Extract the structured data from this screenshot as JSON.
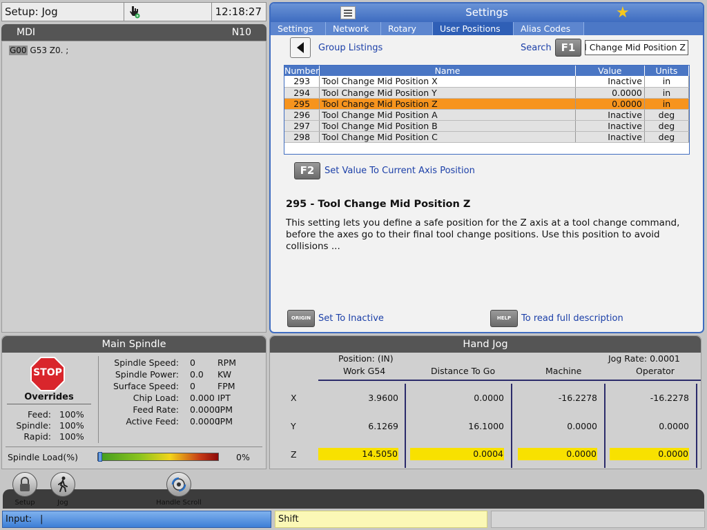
{
  "top": {
    "mode": "Setup: Jog",
    "clock": "12:18:27"
  },
  "mdi": {
    "title": "MDI",
    "line_no": "N10",
    "code_first": "G00",
    "code_rest": " G53 Z0. ;"
  },
  "settings": {
    "title": "Settings",
    "tabs": [
      "Settings",
      "Network",
      "Rotary",
      "User Positions",
      "Alias Codes"
    ],
    "group_listings": "Group Listings",
    "search_label": "Search",
    "f1": "F1",
    "search_value": "Tool Change Mid Position Z",
    "columns": [
      "Number",
      "Name",
      "Value",
      "Units"
    ],
    "rows": [
      {
        "num": "293",
        "name": "Tool Change Mid Position X",
        "value": "Inactive",
        "units": "in"
      },
      {
        "num": "294",
        "name": "Tool Change Mid Position Y",
        "value": "0.0000",
        "units": "in"
      },
      {
        "num": "295",
        "name": "Tool Change Mid Position Z",
        "value": "0.0000",
        "units": "in"
      },
      {
        "num": "296",
        "name": "Tool Change Mid Position A",
        "value": "Inactive",
        "units": "deg"
      },
      {
        "num": "297",
        "name": "Tool Change Mid Position B",
        "value": "Inactive",
        "units": "deg"
      },
      {
        "num": "298",
        "name": "Tool Change Mid Position C",
        "value": "Inactive",
        "units": "deg"
      }
    ],
    "f2": "F2",
    "f2_label": "Set Value To Current Axis Position",
    "desc_title": "295 - Tool Change Mid Position Z",
    "desc_text": "This setting lets you define a safe position for the Z axis at a tool change command, before the axes go to their final tool change positions. Use this position to avoid collisions ...",
    "origin_key": "ORIGIN",
    "origin_label": "Set To Inactive",
    "help_key": "HELP",
    "help_label": "To read full description"
  },
  "spindle": {
    "title": "Main Spindle",
    "stop": "STOP",
    "overrides": "Overrides",
    "ov": [
      {
        "label": "Feed:",
        "value": "100%"
      },
      {
        "label": "Spindle:",
        "value": "100%"
      },
      {
        "label": "Rapid:",
        "value": "100%"
      }
    ],
    "stats": [
      {
        "label": "Spindle Speed:",
        "value": "0",
        "unit": "RPM"
      },
      {
        "label": "Spindle Power:",
        "value": "0.0",
        "unit": "KW"
      },
      {
        "label": "Surface Speed:",
        "value": "0",
        "unit": "FPM"
      },
      {
        "label": "Chip Load:",
        "value": "0.000",
        "unit": "IPT"
      },
      {
        "label": "Feed Rate:",
        "value": "0.0000",
        "unit": "IPM"
      },
      {
        "label": "Active Feed:",
        "value": "0.0000",
        "unit": "IPM"
      }
    ],
    "load_label": "Spindle Load(%)",
    "load_value": "0%",
    "load_fraction": 0
  },
  "jog": {
    "title": "Hand Jog",
    "position_label": "Position: (IN)",
    "jog_rate": "Jog Rate: 0.0001",
    "columns": [
      "Work G54",
      "Distance To Go",
      "Machine",
      "Operator"
    ],
    "rows": [
      {
        "axis": "X",
        "vals": [
          "3.9600",
          "0.0000",
          "-16.2278",
          "-16.2278"
        ],
        "highlight": false
      },
      {
        "axis": "Y",
        "vals": [
          "6.1269",
          "16.1000",
          "0.0000",
          "0.0000"
        ],
        "highlight": false
      },
      {
        "axis": "Z",
        "vals": [
          "14.5050",
          "0.0004",
          "0.0000",
          "0.0000"
        ],
        "highlight": true
      }
    ]
  },
  "shortcuts": [
    {
      "label": "Setup",
      "icon": "lock-icon"
    },
    {
      "label": "Jog",
      "icon": "walking-icon"
    },
    {
      "label": "Handle Scroll",
      "icon": "handle-scroll-icon"
    }
  ],
  "status": {
    "input_label": "Input:",
    "input_value": "|",
    "shift": "Shift"
  },
  "colors": {
    "accent_blue": "#3e6cc0",
    "selected_row": "#f7941d",
    "highlight_yellow": "#f8e100",
    "stop_red": "#d9262c"
  }
}
